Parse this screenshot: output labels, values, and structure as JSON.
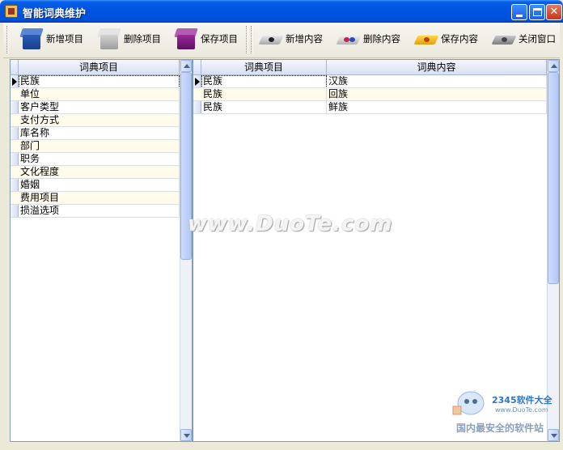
{
  "window": {
    "title": "智能词典维护"
  },
  "toolbar": {
    "left": [
      {
        "label": "新增项目",
        "icon": "new-item-icon",
        "color": "#1f4fa8"
      },
      {
        "label": "删除项目",
        "icon": "delete-item-icon",
        "color": "#b8b8b8"
      },
      {
        "label": "保存项目",
        "icon": "save-item-icon",
        "color": "#8a1f8a"
      }
    ],
    "right": [
      {
        "label": "新增内容",
        "icon": "new-content-icon"
      },
      {
        "label": "删除内容",
        "icon": "delete-content-icon"
      },
      {
        "label": "保存内容",
        "icon": "save-content-icon"
      },
      {
        "label": "关闭窗口",
        "icon": "close-window-icon"
      }
    ]
  },
  "left_grid": {
    "header": "词典项目",
    "rows": [
      "民族",
      "单位",
      "客户类型",
      "支付方式",
      "库名称",
      "部门",
      "职务",
      "文化程度",
      "婚姻",
      "费用项目",
      "损溢选项"
    ],
    "selected_index": 0
  },
  "right_grid": {
    "headers": [
      "词典项目",
      "词典内容"
    ],
    "rows": [
      [
        "民族",
        "汉族"
      ],
      [
        "民族",
        "回族"
      ],
      [
        "民族",
        "鲜族"
      ]
    ],
    "selected_index": 0
  },
  "watermark": {
    "center": "www.DuoTe.com",
    "brand": "2345软件大全",
    "url": "www.DuoTe.com",
    "slogan": "国内最安全的软件站"
  }
}
